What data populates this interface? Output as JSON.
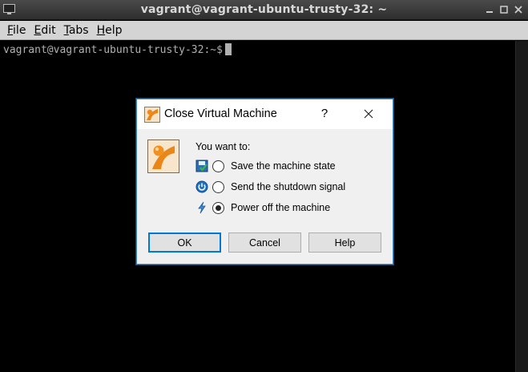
{
  "window": {
    "title": "vagrant@vagrant-ubuntu-trusty-32: ~",
    "icon": "terminal-icon",
    "controls": [
      "minimize-icon",
      "maximize-icon",
      "close-icon"
    ]
  },
  "menubar": {
    "items": [
      {
        "underline": "F",
        "rest": "ile"
      },
      {
        "underline": "E",
        "rest": "dit"
      },
      {
        "underline": "T",
        "rest": "abs"
      },
      {
        "underline": "H",
        "rest": "elp"
      }
    ]
  },
  "terminal": {
    "prompt": "vagrant@vagrant-ubuntu-trusty-32:~$"
  },
  "dialog": {
    "title": "Close Virtual Machine",
    "help_label": "?",
    "prompt": "You want to:",
    "options": [
      {
        "icon": "save-state-icon",
        "label": "Save the machine state",
        "selected": false
      },
      {
        "icon": "shutdown-signal-icon",
        "label": "Send the shutdown signal",
        "selected": false
      },
      {
        "icon": "power-off-icon",
        "label": "Power off the machine",
        "selected": true
      }
    ],
    "buttons": {
      "ok": "OK",
      "cancel": "Cancel",
      "help": "Help"
    }
  },
  "colors": {
    "accent": "#0078d7",
    "dialog_border": "#3b87c7",
    "terminal_bg": "#000000",
    "terminal_fg": "#b0b0b0"
  }
}
